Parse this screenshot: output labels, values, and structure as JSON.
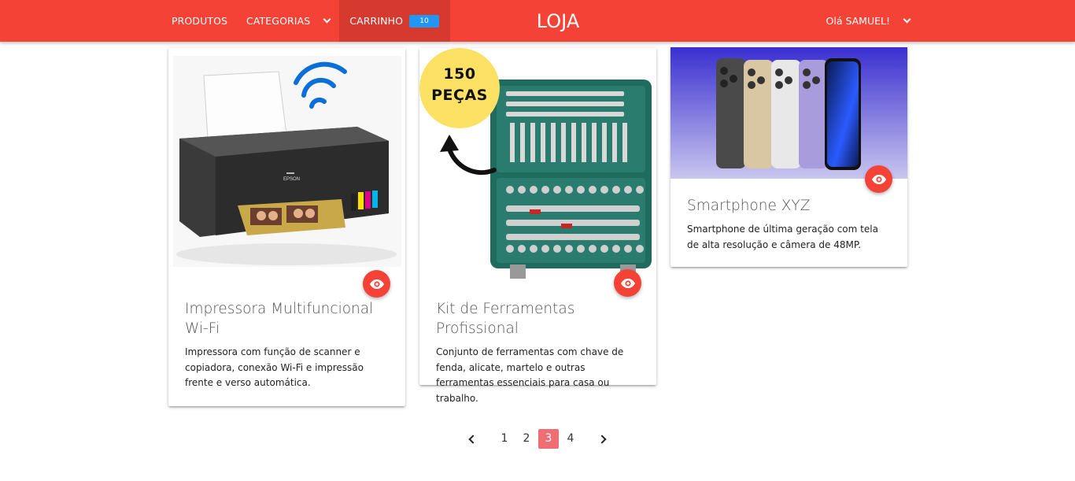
{
  "nav": {
    "produtos": "PRODUTOS",
    "categorias": "CATEGORIAS",
    "carrinho": "CARRINHO",
    "cart_count": "10",
    "brand": "LOJA",
    "user_greeting": "Olá SAMUEL!"
  },
  "products": [
    {
      "title": "Impressora Multifuncional Wi-Fi",
      "description": "Impressora com função de scanner e copiadora, conexão Wi-Fi e impressão frente e verso automática.",
      "image_label": "EPSON"
    },
    {
      "title": "Kit de Ferramentas Profissional",
      "description": "Conjunto de ferramentas com chave de fenda, alicate, martelo e outras ferramentas essenciais para casa ou trabalho.",
      "badge_line1": "150",
      "badge_line2": "PEÇAS"
    },
    {
      "title": "Smartphone XYZ",
      "description": "Smartphone de última geração com tela de alta resolução e câmera de 48MP."
    }
  ],
  "pagination": {
    "pages": [
      "1",
      "2",
      "3",
      "4"
    ],
    "current": "3"
  },
  "colors": {
    "primary": "#f44336",
    "badge": "#2196f3",
    "active_page": "#ee6e73"
  }
}
